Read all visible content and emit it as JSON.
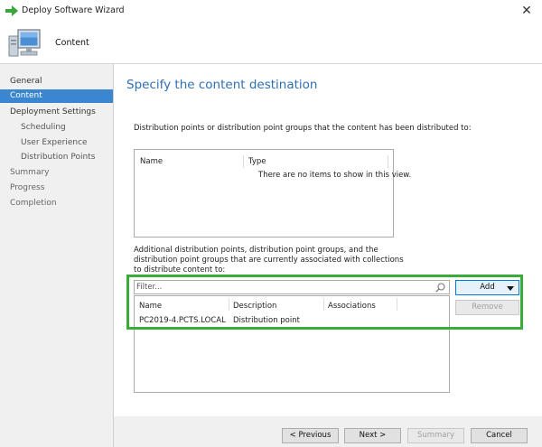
{
  "window": {
    "title": "Deploy Software Wizard",
    "close_glyph": "✕"
  },
  "header": {
    "title": "Content",
    "icon": "computer-icon"
  },
  "nav": {
    "items": [
      {
        "label": "General",
        "level": 0,
        "active": false
      },
      {
        "label": "Content",
        "level": 0,
        "active": true
      },
      {
        "label": "Deployment Settings",
        "level": 0,
        "active": false
      },
      {
        "label": "Scheduling",
        "level": 1,
        "active": false
      },
      {
        "label": "User Experience",
        "level": 1,
        "active": false
      },
      {
        "label": "Distribution Points",
        "level": 1,
        "active": false
      },
      {
        "label": "Summary",
        "level": 0,
        "active": false
      },
      {
        "label": "Progress",
        "level": 0,
        "active": false
      },
      {
        "label": "Completion",
        "level": 0,
        "active": false
      }
    ]
  },
  "main": {
    "heading": "Specify the content destination",
    "distributed_label": "Distribution points or distribution point groups that the content has been distributed to:",
    "distributed_list": {
      "columns": [
        "Name",
        "Type"
      ],
      "empty_text": "There are no items to show in this view."
    },
    "additional_label": "Additional distribution points, distribution point groups, and the distribution point groups that are currently associated with collections to distribute content to:",
    "filter": {
      "placeholder": "Filter...",
      "value": ""
    },
    "additional_list": {
      "columns": [
        "Name",
        "Description",
        "Associations"
      ],
      "rows": [
        {
          "name": "PC2019-4.PCTS.LOCAL",
          "description": "Distribution point",
          "associations": ""
        }
      ]
    },
    "add_button": "Add",
    "remove_button": "Remove"
  },
  "footer": {
    "previous": "< Previous",
    "next": "Next >",
    "summary": "Summary",
    "cancel": "Cancel"
  },
  "colors": {
    "accent": "#3a86cf",
    "heading": "#2f6fb6",
    "highlight": "#3aac3a"
  }
}
